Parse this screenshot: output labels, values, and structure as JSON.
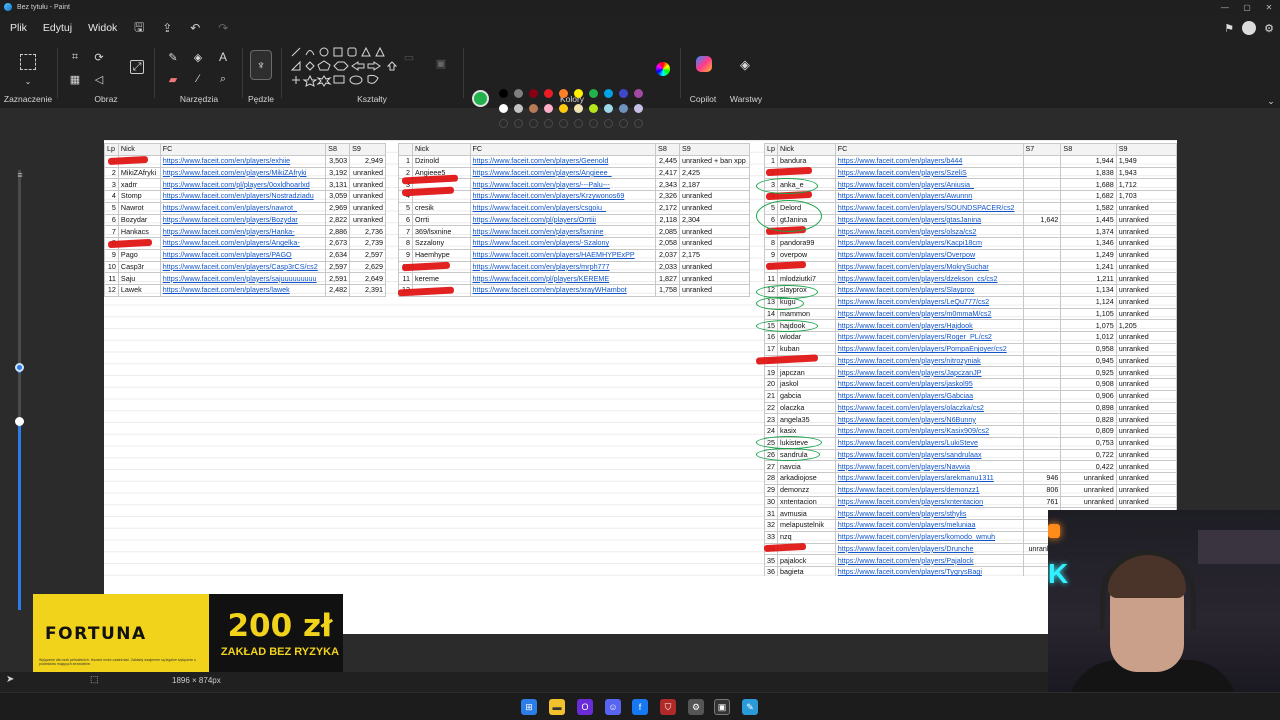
{
  "window": {
    "title": "Bez tytułu - Paint",
    "controls": [
      "—",
      "▢",
      "✕"
    ]
  },
  "menu": {
    "items": [
      "Plik",
      "Edytuj",
      "Widok"
    ]
  },
  "ribbon": {
    "groups": [
      "Zaznaczenie",
      "Obraz",
      "Narzędzia",
      "Pędzle",
      "Kształty",
      "Kolory",
      "Copilot",
      "Warstwy"
    ],
    "current_color": "#22b14c",
    "secondary_color": "#ffffff",
    "palette": [
      "#000000",
      "#7f7f7f",
      "#880015",
      "#ed1c24",
      "#ff7f27",
      "#fff200",
      "#22b14c",
      "#00a2e8",
      "#3f48cc",
      "#a349a4",
      "#ffffff",
      "#c3c3c3",
      "#b97a57",
      "#ffaec9",
      "#ffc90e",
      "#efe4b0",
      "#b5e61d",
      "#99d9ea",
      "#7092be",
      "#c8bfe7"
    ]
  },
  "status": {
    "canvas_size": "1896 × 874px"
  },
  "ad": {
    "brand": "FORTUNA",
    "amount": "200 zł",
    "sub": "ZAKŁAD BEZ RYZYKA",
    "fine": "Wyłącznie dla osób pełnoletnich. Hazard może uzależniać. Zakłady wzajemne są legalne wyłącznie u podmiotów mających zezwolenie."
  },
  "webcam": {
    "neon": "K"
  },
  "table1": {
    "headers": [
      "Lp",
      "Nick",
      "FC",
      "S8",
      "S9"
    ],
    "rows": [
      [
        "1",
        "",
        "https://www.faceit.com/en/players/exhiie",
        "3,503",
        "2,949"
      ],
      [
        "2",
        "MikiZAfryki",
        "https://www.faceit.com/en/players/MikiZAfryki",
        "3,192",
        "unranked"
      ],
      [
        "3",
        "xadrr",
        "https://www.faceit.com/pl/players/0oxldhoarlxd",
        "3,131",
        "unranked"
      ],
      [
        "4",
        "Stomp",
        "https://www.faceit.com/en/players/Nostradziadu",
        "3,059",
        "unranked"
      ],
      [
        "5",
        "Nawrot",
        "https://www.faceit.com/en/players/nawrot_",
        "2,969",
        "unranked"
      ],
      [
        "6",
        "Bozydar",
        "https://www.faceit.com/en/players/Bozydar",
        "2,822",
        "unranked"
      ],
      [
        "7",
        "Hankacs",
        "https://www.faceit.com/en/players/Hanka-",
        "2,886",
        "2,736"
      ],
      [
        "8",
        "",
        "https://www.faceit.com/en/players/Angelka-",
        "2,673",
        "2,739"
      ],
      [
        "9",
        "Pago",
        "https://www.faceit.com/en/players/PAGO",
        "2,634",
        "2,597"
      ],
      [
        "10",
        "Casp3r",
        "https://www.faceit.com/en/players/Casp3rCS/cs2",
        "2,597",
        "2,629"
      ],
      [
        "11",
        "Saju",
        "https://www.faceit.com/en/players/sajuuuuuuuuu",
        "2,591",
        "2,649"
      ],
      [
        "12",
        "Lawek",
        "https://www.faceit.com/en/players/lawek",
        "2,482",
        "2,391"
      ]
    ]
  },
  "table2": {
    "headers": [
      "",
      "Nick",
      "FC",
      "S8",
      "S9"
    ],
    "rows": [
      [
        "1",
        "Dzinold",
        "https://www.faceit.com/en/players/Geenold",
        "2,445",
        "unranked + ban xpp"
      ],
      [
        "2",
        "Angieee5",
        "https://www.faceit.com/en/players/Angieee_",
        "2,417",
        "2,425"
      ],
      [
        "3",
        "",
        "https://www.faceit.com/en/players/---Palu---",
        "2,343",
        "2,187"
      ],
      [
        "4",
        "",
        "https://www.faceit.com/en/players/Krzywonos69",
        "2,326",
        "unranked"
      ],
      [
        "5",
        "cresik",
        "https://www.faceit.com/en/players/csgoiu_",
        "2,172",
        "unranked"
      ],
      [
        "6",
        "Orrti",
        "https://www.faceit.com/pl/players/Orrtiii",
        "2,118",
        "2,304"
      ],
      [
        "7",
        "369/lsxnine",
        "https://www.faceit.com/en/players/lsxnine",
        "2,085",
        "unranked"
      ],
      [
        "8",
        "Szzalony",
        "https://www.faceit.com/en/players/-Szalony",
        "2,058",
        "unranked"
      ],
      [
        "9",
        "Haemhype",
        "https://www.faceit.com/en/players/HAEMHYPExPP",
        "2,037",
        "2,175"
      ],
      [
        "10",
        "",
        "https://www.faceit.com/en/players/mrph777",
        "2,033",
        "unranked"
      ],
      [
        "11",
        "kereme",
        "https://www.faceit.com/pl/players/KEREME",
        "1,827",
        "unranked"
      ],
      [
        "12",
        "",
        "https://www.faceit.com/en/players/xrayWHambot",
        "1,758",
        "unranked"
      ]
    ]
  },
  "table3": {
    "headers": [
      "Lp",
      "Nick",
      "FC",
      "S7",
      "S8",
      "S9"
    ],
    "rows": [
      [
        "1",
        "bandura",
        "https://www.faceit.com/en/players/b444",
        "",
        "1,944",
        "1,949"
      ],
      [
        "2",
        "",
        "https://www.faceit.com/en/players/SzeliS",
        "",
        "1,838",
        "1,943"
      ],
      [
        "3",
        "anka_e",
        "https://www.faceit.com/en/players/Aniusia_",
        "",
        "1,688",
        "1,712"
      ],
      [
        "4",
        "",
        "https://www.faceit.com/en/players/Awunnn",
        "",
        "1,682",
        "1,703"
      ],
      [
        "5",
        "Delord",
        "https://www.faceit.com/en/players/SOUNDSPACER/cs2",
        "",
        "1,582",
        "unranked"
      ],
      [
        "6",
        "gtJanina",
        "https://www.faceit.com/en/players/gtasJanina",
        "1,642",
        "1,445",
        "unranked"
      ],
      [
        "7",
        "",
        "https://www.faceit.com/en/players/olsza/cs2",
        "",
        "1,374",
        "unranked"
      ],
      [
        "8",
        "pandora99",
        "https://www.faceit.com/en/players/Kacpi18cm",
        "",
        "1,346",
        "unranked"
      ],
      [
        "9",
        "overpow",
        "https://www.faceit.com/en/players/Overpow",
        "",
        "1,249",
        "unranked"
      ],
      [
        "10",
        "",
        "https://www.faceit.com/en/players/MokrySuchar",
        "",
        "1,241",
        "unranked"
      ],
      [
        "11",
        "mlodziutki7",
        "https://www.faceit.com/en/players/dzekson_cs/cs2",
        "",
        "1,211",
        "unranked"
      ],
      [
        "12",
        "slayprox",
        "https://www.faceit.com/en/players/Slayprox",
        "",
        "1,134",
        "unranked"
      ],
      [
        "13",
        "kugu",
        "https://www.faceit.com/en/players/LeQu777/cs2",
        "",
        "1,124",
        "unranked"
      ],
      [
        "14",
        "mammon",
        "https://www.faceit.com/en/players/m0mmaM/cs2",
        "",
        "1,105",
        "unranked"
      ],
      [
        "15",
        "hajdook",
        "https://www.faceit.com/en/players/Hajdook",
        "",
        "1,075",
        "1,205"
      ],
      [
        "16",
        "wlodar",
        "https://www.faceit.com/en/players/Roger_PL/cs2",
        "",
        "1,012",
        "unranked"
      ],
      [
        "17",
        "kuban",
        "https://www.faceit.com/en/players/PompaEnjoyer/cs2",
        "",
        "0,958",
        "unranked"
      ],
      [
        "18",
        "",
        "https://www.faceit.com/en/players/nitrozyniak",
        "",
        "0,945",
        "unranked"
      ],
      [
        "19",
        "japczan",
        "https://www.faceit.com/en/players/JapczanJP",
        "",
        "0,925",
        "unranked"
      ],
      [
        "20",
        "jaskol",
        "https://www.faceit.com/en/players/jaskol95",
        "",
        "0,908",
        "unranked"
      ],
      [
        "21",
        "gabcia",
        "https://www.faceit.com/en/players/Gabciaa",
        "",
        "0,906",
        "unranked"
      ],
      [
        "22",
        "olaczka",
        "https://www.faceit.com/en/players/olaczka/cs2",
        "",
        "0,898",
        "unranked"
      ],
      [
        "23",
        "angela35",
        "https://www.faceit.com/en/players/N6Bunny",
        "",
        "0,828",
        "unranked"
      ],
      [
        "24",
        "kasix",
        "https://www.faceit.com/en/players/Kasix909/cs2",
        "",
        "0,809",
        "unranked"
      ],
      [
        "25",
        "lukisteve",
        "https://www.faceit.com/en/players/LukiSteve",
        "",
        "0,753",
        "unranked"
      ],
      [
        "26",
        "sandrula",
        "https://www.faceit.com/en/players/sandrulaax",
        "",
        "0,722",
        "unranked"
      ],
      [
        "27",
        "navcia",
        "https://www.faceit.com/en/players/Navwia",
        "",
        "0,422",
        "unranked"
      ],
      [
        "28",
        "arkadiojose",
        "https://www.faceit.com/en/players/arekmanu1311",
        "946",
        "unranked",
        "unranked"
      ],
      [
        "29",
        "demonzz",
        "https://www.faceit.com/en/players/demonzz1",
        "806",
        "unranked",
        "unranked"
      ],
      [
        "30",
        "xntentacion",
        "https://www.faceit.com/en/players/xntentacion",
        "761",
        "unranked",
        "unranked"
      ],
      [
        "31",
        "avmusia",
        "https://www.faceit.com/en/players/sthylis",
        "",
        "",
        ""
      ],
      [
        "32",
        "melapustelnik",
        "https://www.faceit.com/en/players/meluniaa",
        "",
        "",
        ""
      ],
      [
        "33",
        "nzq",
        "https://www.faceit.com/en/players/komodo_wmuh",
        "",
        "",
        ""
      ],
      [
        "34",
        "",
        "https://www.faceit.com/en/players/Drunche",
        "unranked",
        "",
        ""
      ],
      [
        "35",
        "pajalock",
        "https://www.faceit.com/en/players/Pajalock",
        "1,",
        "",
        ""
      ],
      [
        "36",
        "bagieta",
        "https://www.faceit.com/en/players/TygrysBagi",
        "",
        "",
        ""
      ]
    ]
  }
}
